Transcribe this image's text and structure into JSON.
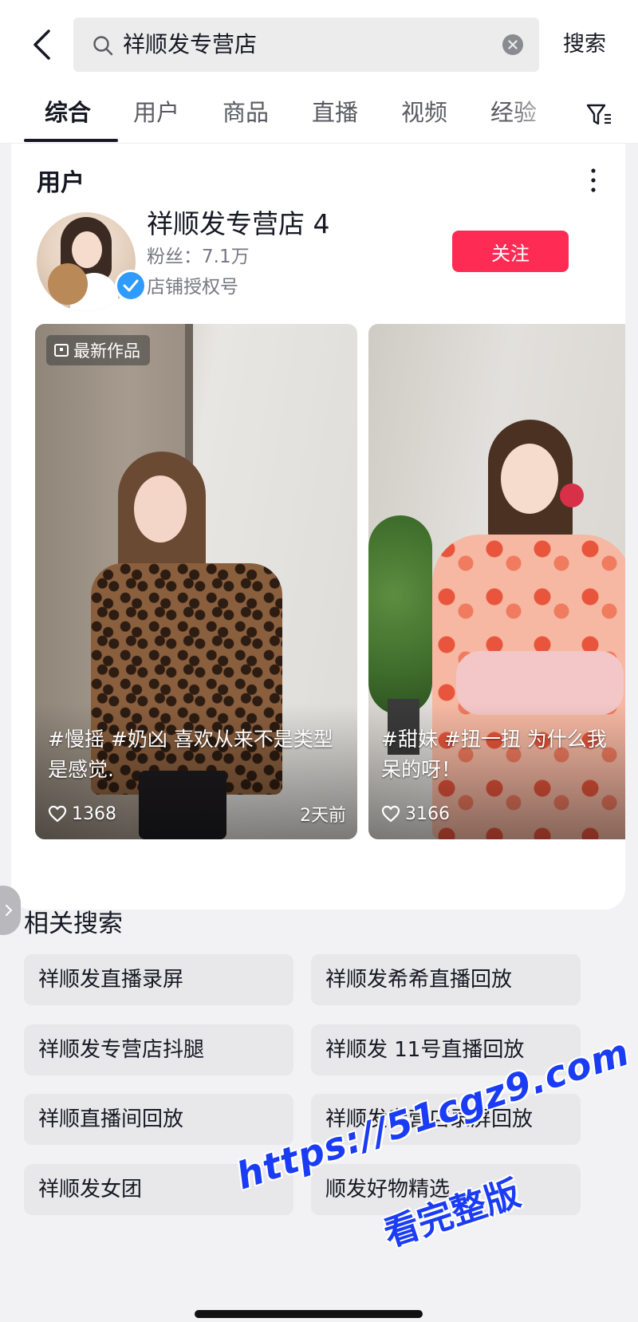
{
  "header": {
    "query": "祥顺发专营店",
    "submit_label": "搜索",
    "back_icon": "chevron-left-icon",
    "search_icon": "search-icon",
    "clear_icon": "clear-icon"
  },
  "tabs": [
    {
      "label": "综合",
      "active": true
    },
    {
      "label": "用户",
      "active": false
    },
    {
      "label": "商品",
      "active": false
    },
    {
      "label": "直播",
      "active": false
    },
    {
      "label": "视频",
      "active": false
    },
    {
      "label": "经验",
      "active": false
    }
  ],
  "user_card": {
    "title": "用户",
    "name": "祥顺发专营店 4",
    "fans": "粉丝：7.1万",
    "tag": "店铺授权号",
    "follow_label": "关注",
    "verified": true,
    "videos": [
      {
        "badge": "最新作品",
        "caption_line1": "#慢摇 #奶凶 喜欢从来不是类型",
        "caption_line2": "是感觉.",
        "likes": "1368",
        "time": "2天前"
      },
      {
        "badge": "",
        "caption_line1": "#甜妹 #扭一扭 为什么我",
        "caption_line2": "呆的呀！",
        "likes": "3166",
        "time": ""
      }
    ]
  },
  "related": {
    "title": "相关搜索",
    "items": [
      "祥顺发直播录屏",
      "祥顺发希希直播回放",
      "祥顺发专营店抖腿",
      "祥顺发 11号直播回放",
      "祥顺直播间回放",
      "祥顺发专营店录屏回放",
      "祥顺发女团",
      "顺发好物精选"
    ]
  },
  "watermark": {
    "line1": "https://51cgz9.com",
    "line2": "看完整版"
  },
  "colors": {
    "accent": "#fe2c55",
    "verified": "#2f9bff",
    "watermark": "#1a3cf5"
  }
}
